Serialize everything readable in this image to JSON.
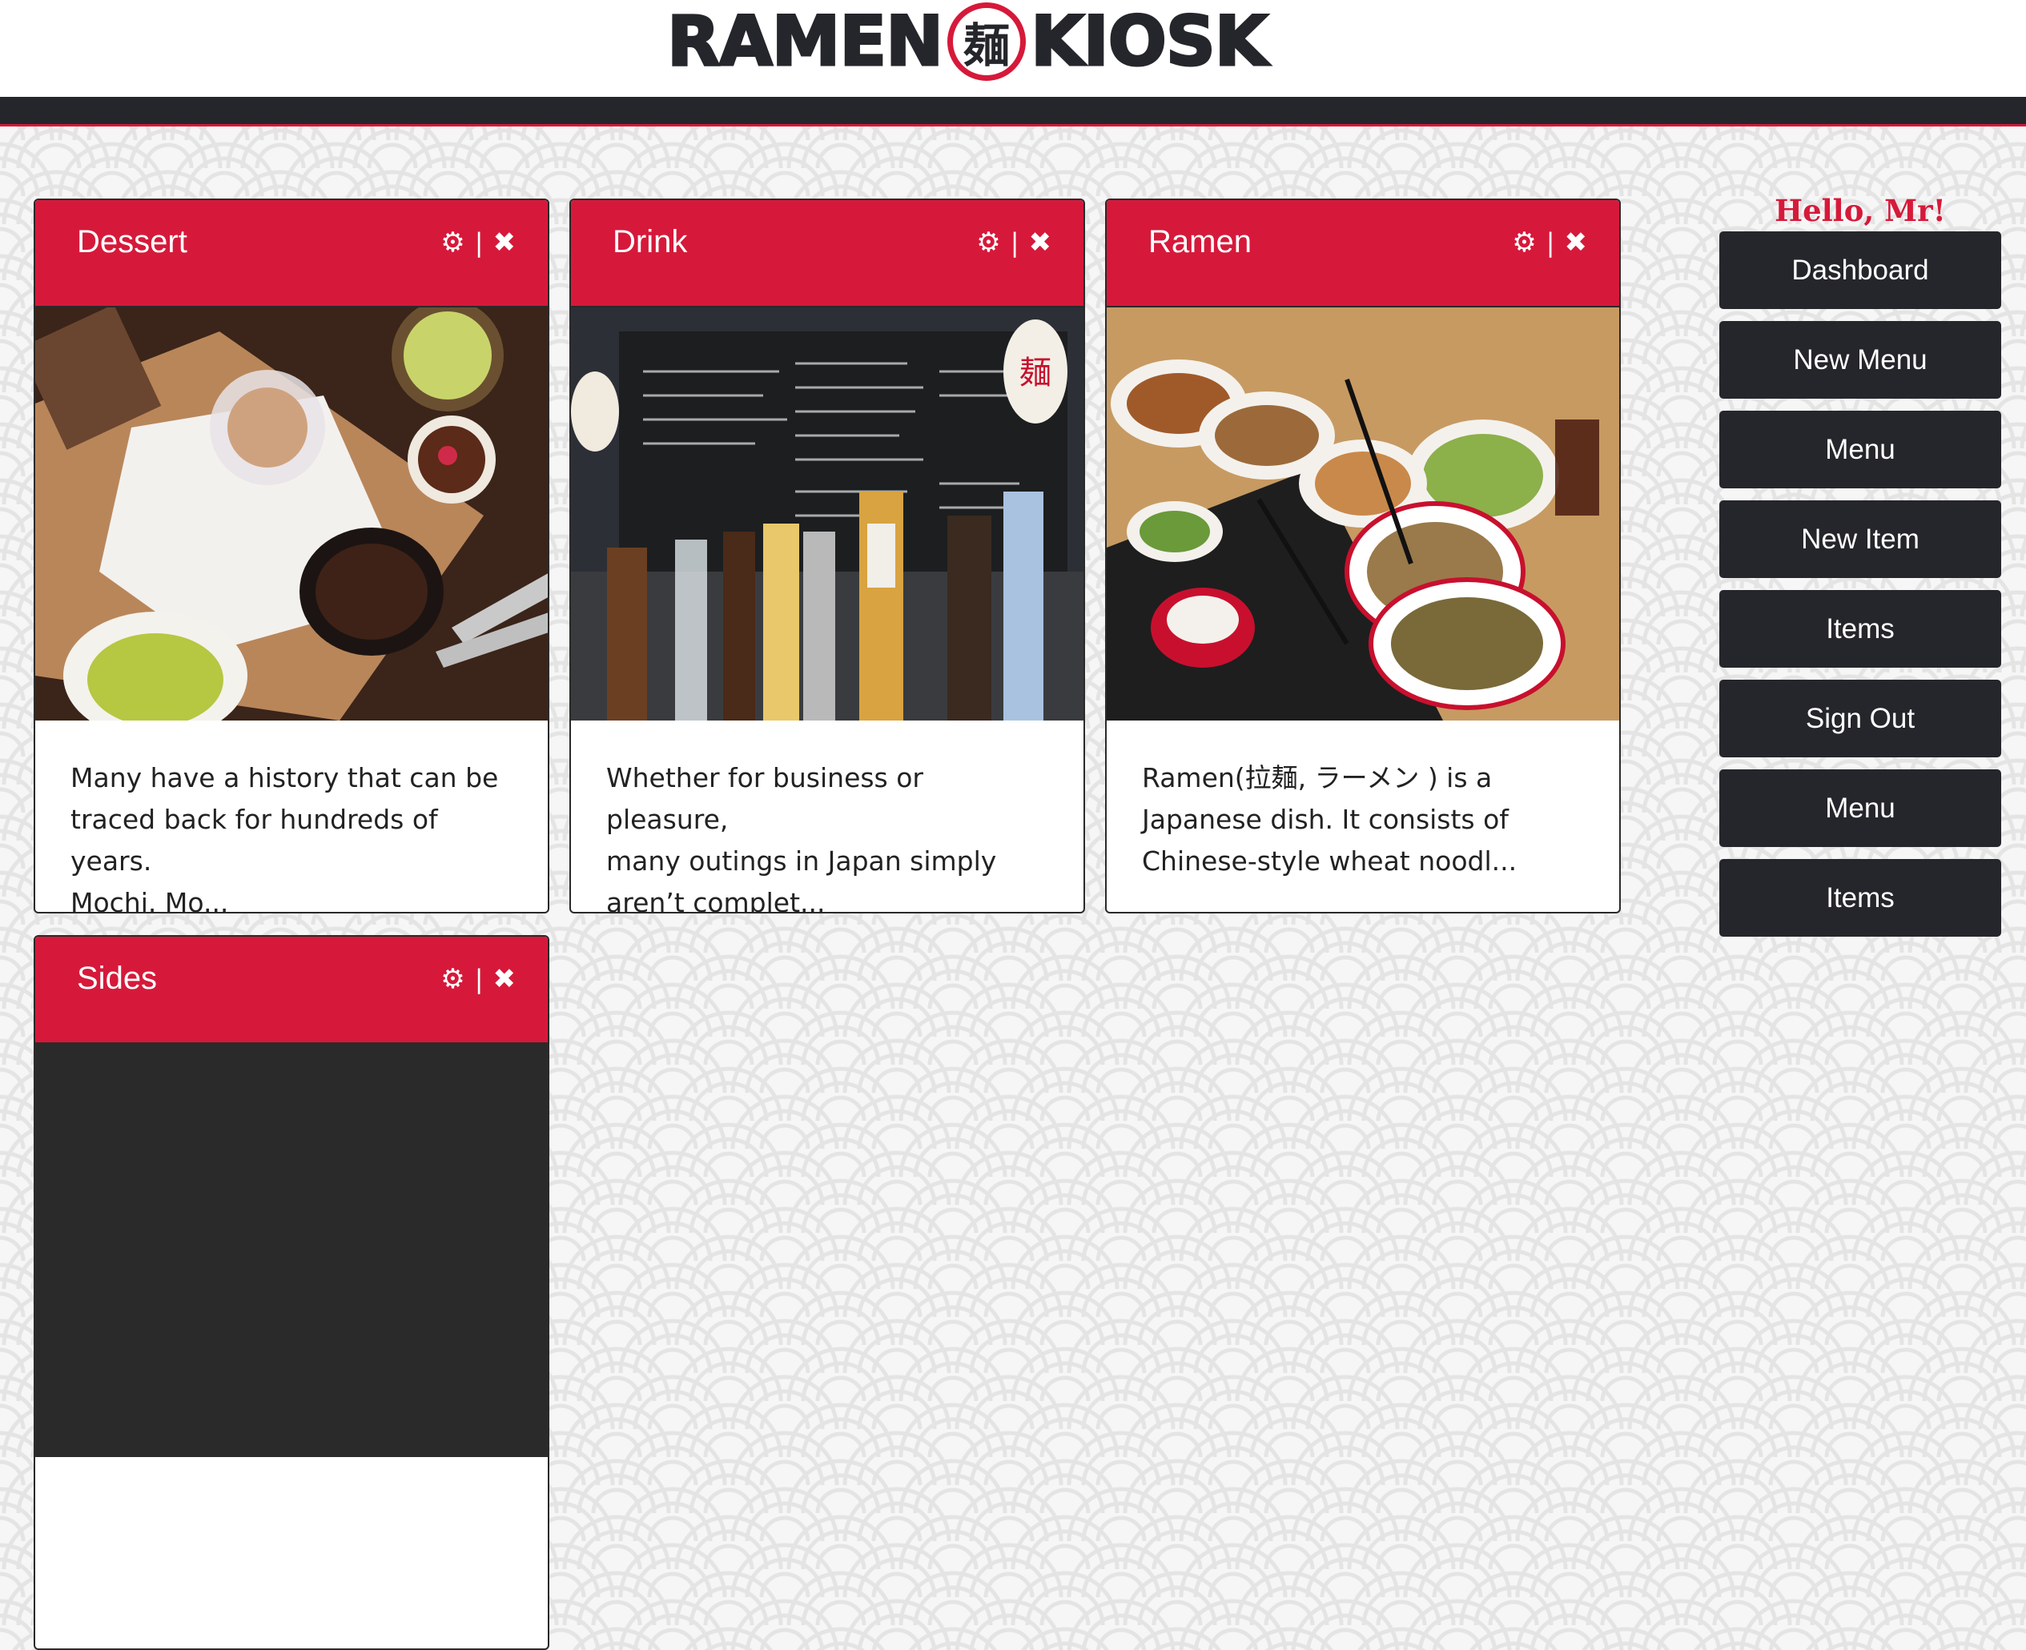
{
  "app": {
    "logo_left": "RAMEN",
    "logo_seal": "麺",
    "logo_right": "KIOSK",
    "brand_red": "#d6193a",
    "dark": "#25262b"
  },
  "cards": [
    {
      "title": "Dessert",
      "settings_icon": "gear-icon",
      "separator": "|",
      "delete_icon": "close-icon",
      "image_subject": "dessert-photo",
      "excerpt_lines": [
        "Many have a history that can be",
        "traced back for hundreds of years.",
        "Mochi. Mo..."
      ]
    },
    {
      "title": "Drink",
      "settings_icon": "gear-icon",
      "separator": "|",
      "delete_icon": "close-icon",
      "image_subject": "drink-photo",
      "excerpt_lines": [
        "Whether for business or pleasure,",
        "many outings in Japan simply",
        "aren’t complet..."
      ]
    },
    {
      "title": "Ramen",
      "settings_icon": "gear-icon",
      "separator": "|",
      "delete_icon": "close-icon",
      "image_subject": "ramen-photo",
      "excerpt_lines": [
        "Ramen(拉麺, ラーメン ) is a",
        "Japanese dish. It consists of",
        "Chinese-style wheat noodl..."
      ]
    },
    {
      "title": "Sides",
      "settings_icon": "gear-icon",
      "separator": "|",
      "delete_icon": "close-icon",
      "image_subject": "sides-photo",
      "excerpt_lines": [
        "",
        "",
        ""
      ]
    }
  ],
  "sidebar": {
    "greeting": "Hello, Mr!",
    "buttons": [
      {
        "label": "Dashboard"
      },
      {
        "label": "New Menu"
      },
      {
        "label": "Menu"
      },
      {
        "label": "New Item"
      },
      {
        "label": "Items"
      },
      {
        "label": "Sign Out"
      },
      {
        "label": "Menu"
      },
      {
        "label": "Items"
      }
    ]
  }
}
